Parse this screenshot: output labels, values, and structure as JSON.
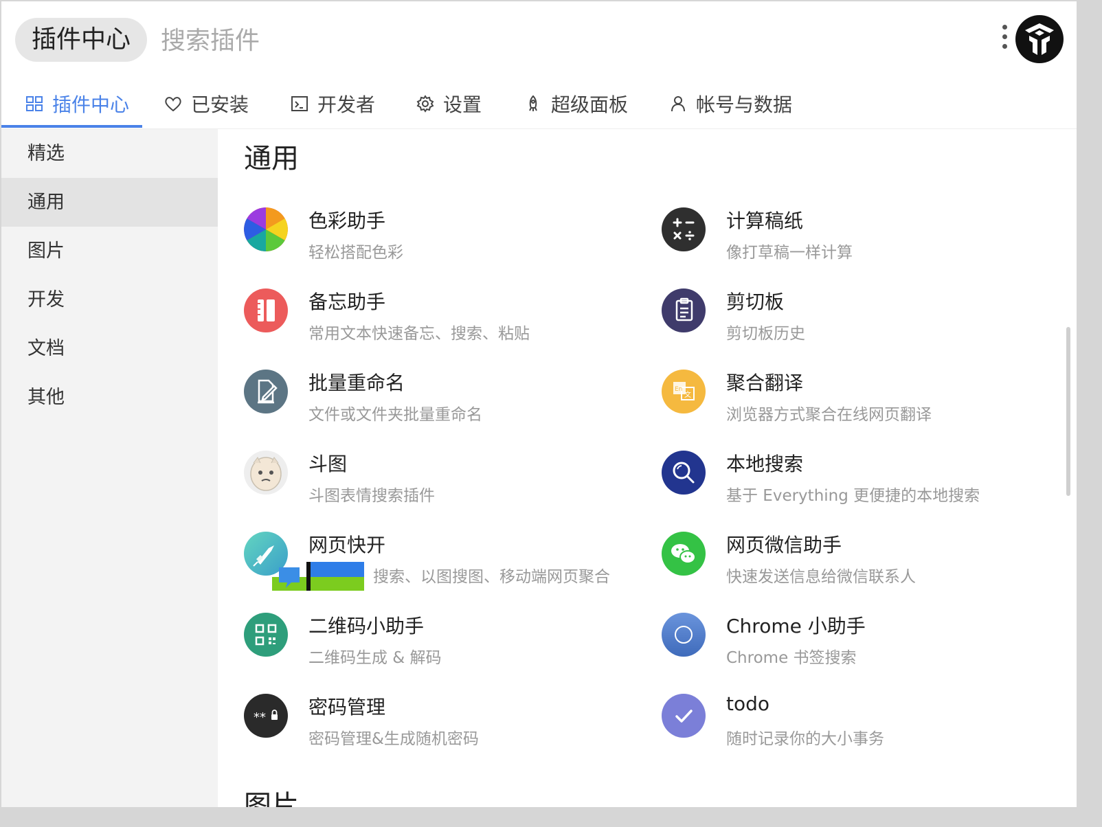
{
  "header": {
    "app_title": "插件中心",
    "search_placeholder": "搜索插件"
  },
  "tabs": [
    {
      "label": "插件中心",
      "icon": "grid-icon",
      "active": true
    },
    {
      "label": "已安装",
      "icon": "heart-icon"
    },
    {
      "label": "开发者",
      "icon": "terminal-icon"
    },
    {
      "label": "设置",
      "icon": "gear-icon"
    },
    {
      "label": "超级面板",
      "icon": "rocket-icon"
    },
    {
      "label": "帐号与数据",
      "icon": "user-icon"
    }
  ],
  "sidebar": {
    "items": [
      {
        "label": "精选"
      },
      {
        "label": "通用",
        "active": true
      },
      {
        "label": "图片"
      },
      {
        "label": "开发"
      },
      {
        "label": "文档"
      },
      {
        "label": "其他"
      }
    ]
  },
  "main": {
    "section_title": "通用",
    "next_section_title": "图片",
    "plugins": [
      {
        "name": "色彩助手",
        "desc": "轻松搭配色彩",
        "icon": "color-wheel-icon"
      },
      {
        "name": "计算稿纸",
        "desc": "像打草稿一样计算",
        "icon": "calculator-icon",
        "color": "#2f2f2f"
      },
      {
        "name": "备忘助手",
        "desc": "常用文本快速备忘、搜索、粘贴",
        "icon": "notebook-icon",
        "color": "#ec5b5b"
      },
      {
        "name": "剪切板",
        "desc": "剪切板历史",
        "icon": "clipboard-icon",
        "color": "#3f3b6b"
      },
      {
        "name": "批量重命名",
        "desc": "文件或文件夹批量重命名",
        "icon": "rename-icon",
        "color": "#5c7584"
      },
      {
        "name": "聚合翻译",
        "desc": "浏览器方式聚合在线网页翻译",
        "icon": "translate-icon",
        "color": "#f5b93f"
      },
      {
        "name": "斗图",
        "desc": "斗图表情搜索插件",
        "icon": "meme-face-icon"
      },
      {
        "name": "本地搜索",
        "desc": "基于 Everything 更便捷的本地搜索",
        "icon": "magnifier-icon",
        "color": "#22358f"
      },
      {
        "name": "网页快开",
        "desc": "搜索、以图搜图、移动端网页聚合",
        "icon": "rocket-launch-icon",
        "color": "#4fc6b5"
      },
      {
        "name": "网页微信助手",
        "desc": "快速发送信息给微信联系人",
        "icon": "wechat-icon",
        "color": "#34c245"
      },
      {
        "name": "二维码小助手",
        "desc": "二维码生成 & 解码",
        "icon": "qrcode-icon",
        "color": "#2e9e7b"
      },
      {
        "name": "Chrome 小助手",
        "desc": "Chrome 书签搜索",
        "icon": "chrome-icon",
        "color": "#4a78c9"
      },
      {
        "name": "密码管理",
        "desc": "密码管理&生成随机密码",
        "icon": "password-icon",
        "color": "#2a2a2a"
      },
      {
        "name": "todo",
        "desc": "随时记录你的大小事务",
        "icon": "check-icon",
        "color": "#7b7fd8"
      }
    ]
  },
  "colors": {
    "accent": "#4a82e8",
    "sidebar_bg": "#f3f3f3",
    "sidebar_active_bg": "#e3e3e3"
  }
}
